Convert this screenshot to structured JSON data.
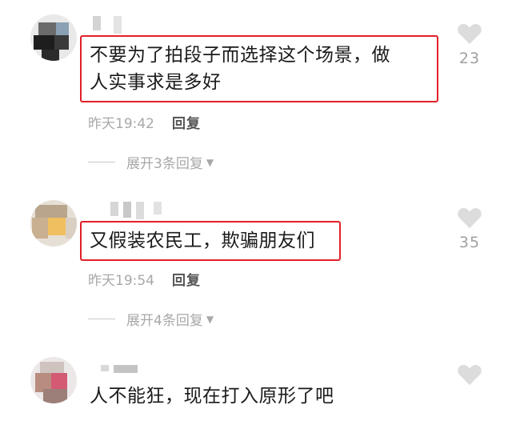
{
  "colors": {
    "highlight": "#e2202a",
    "meta": "#a8a8a8",
    "reply": "#555555",
    "heart": "#dcdcdc"
  },
  "comments": [
    {
      "text_line1": "不要为了拍段子而选择这个场景，做",
      "text_line2": "人实事求是多好",
      "time": "昨天19:42",
      "reply_label": "回复",
      "expand_label": "展开3条回复",
      "like_count": "23",
      "highlighted": true
    },
    {
      "text_line1": "又假装农民工，欺骗朋友们",
      "time": "昨天19:54",
      "reply_label": "回复",
      "expand_label": "展开4条回复",
      "like_count": "35",
      "highlighted": true
    },
    {
      "text_line1": "人不能狂，现在打入原形了吧",
      "highlighted": false
    }
  ],
  "icons": {
    "like": "heart-icon",
    "expand": "caret-down-icon"
  }
}
